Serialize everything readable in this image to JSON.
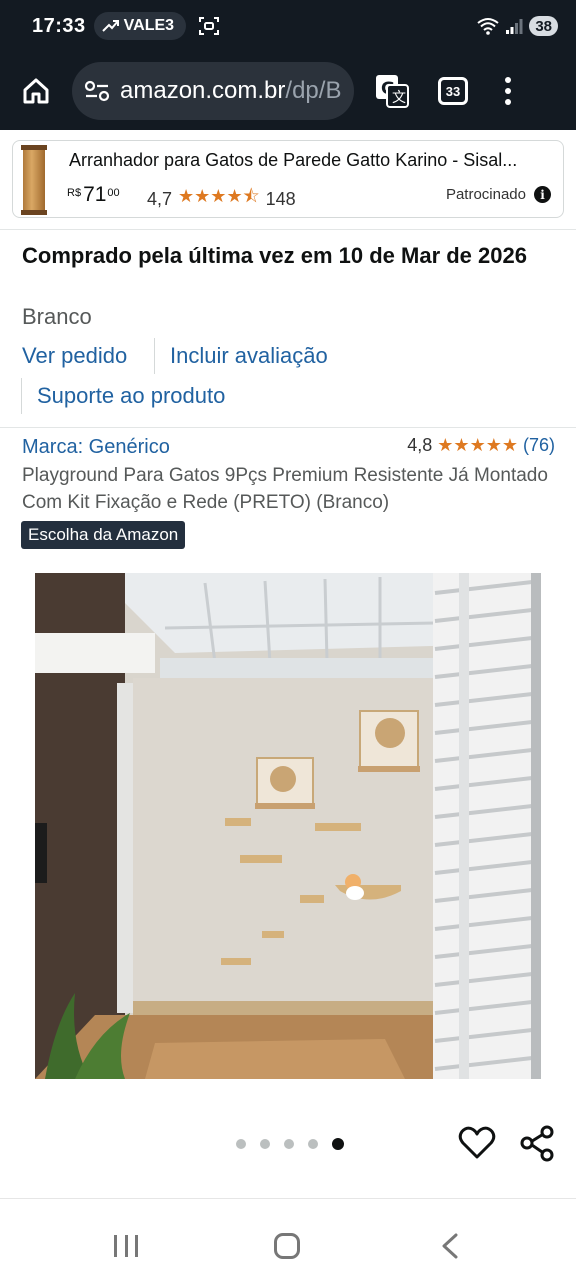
{
  "status_bar": {
    "time": "17:33",
    "ticker": "VALE3",
    "battery": "38"
  },
  "browser": {
    "url_main": "amazon.com.br",
    "url_path": "/dp/B",
    "tab_count": "33"
  },
  "sponsored_ad": {
    "title": "Arranhador para Gatos de Parede Gatto Karino - Sisal...",
    "currency": "R$",
    "price_whole": "71",
    "price_cents": "00",
    "rating": "4,7",
    "stars": "★★★★⯪",
    "reviews": "148",
    "label": "Patrocinado"
  },
  "purchase": {
    "last_purchased": "Comprado pela última vez em 10 de Mar de 2026",
    "variant": "Branco",
    "view_order": "Ver pedido",
    "write_review": "Incluir avaliação",
    "product_support": "Suporte ao produto"
  },
  "product": {
    "brand": "Marca: Genérico",
    "rating": "4,8",
    "stars": "★★★★★",
    "review_count": "(76)",
    "title": "Playground Para Gatos 9Pçs Premium Resistente Já Montado Com Kit Fixação e Rede (PRETO) (Branco)",
    "badge": "Escolha da Amazon"
  },
  "carousel": {
    "total": 5,
    "active_index": 5
  },
  "colors": {
    "link": "#2162a1",
    "star": "#de7921",
    "header_bg": "#131a22",
    "badge_bg": "#232f3e"
  }
}
